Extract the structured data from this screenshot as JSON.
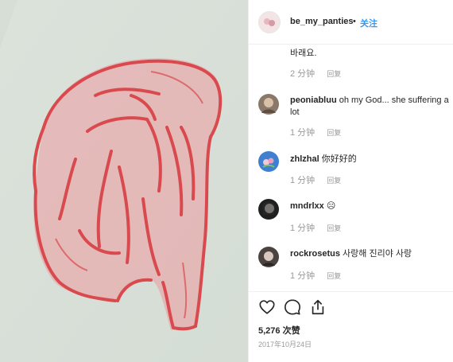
{
  "post": {
    "username": "be_my_panties",
    "separator": "•",
    "follow_label": "关注"
  },
  "comments": [
    {
      "text": "바래요.",
      "time": "2 分钟",
      "reply": "回复"
    },
    {
      "user": "peoniabluu",
      "text": "oh my God... she suffering a lot",
      "time": "1 分钟",
      "reply": "回复"
    },
    {
      "user": "zhlzhal",
      "text": "你好好的",
      "time": "1 分钟",
      "reply": "回复"
    },
    {
      "user": "mndrlxx",
      "text": "☹",
      "time": "1 分钟",
      "reply": "回复"
    },
    {
      "user": "rockrosetus",
      "text": "사랑해 진리야 사랑",
      "time": "1 分钟",
      "reply": "回复"
    }
  ],
  "footer": {
    "likes": "5,276 次赞",
    "date": "2017年10月24日"
  },
  "icons": {
    "like": "heart-icon",
    "comment": "comment-bubble-icon",
    "share": "share-icon"
  },
  "colors": {
    "accent": "#3897f0",
    "drawing": "#d94a4f",
    "paper": "#d3dcd4",
    "muted": "#999999"
  }
}
